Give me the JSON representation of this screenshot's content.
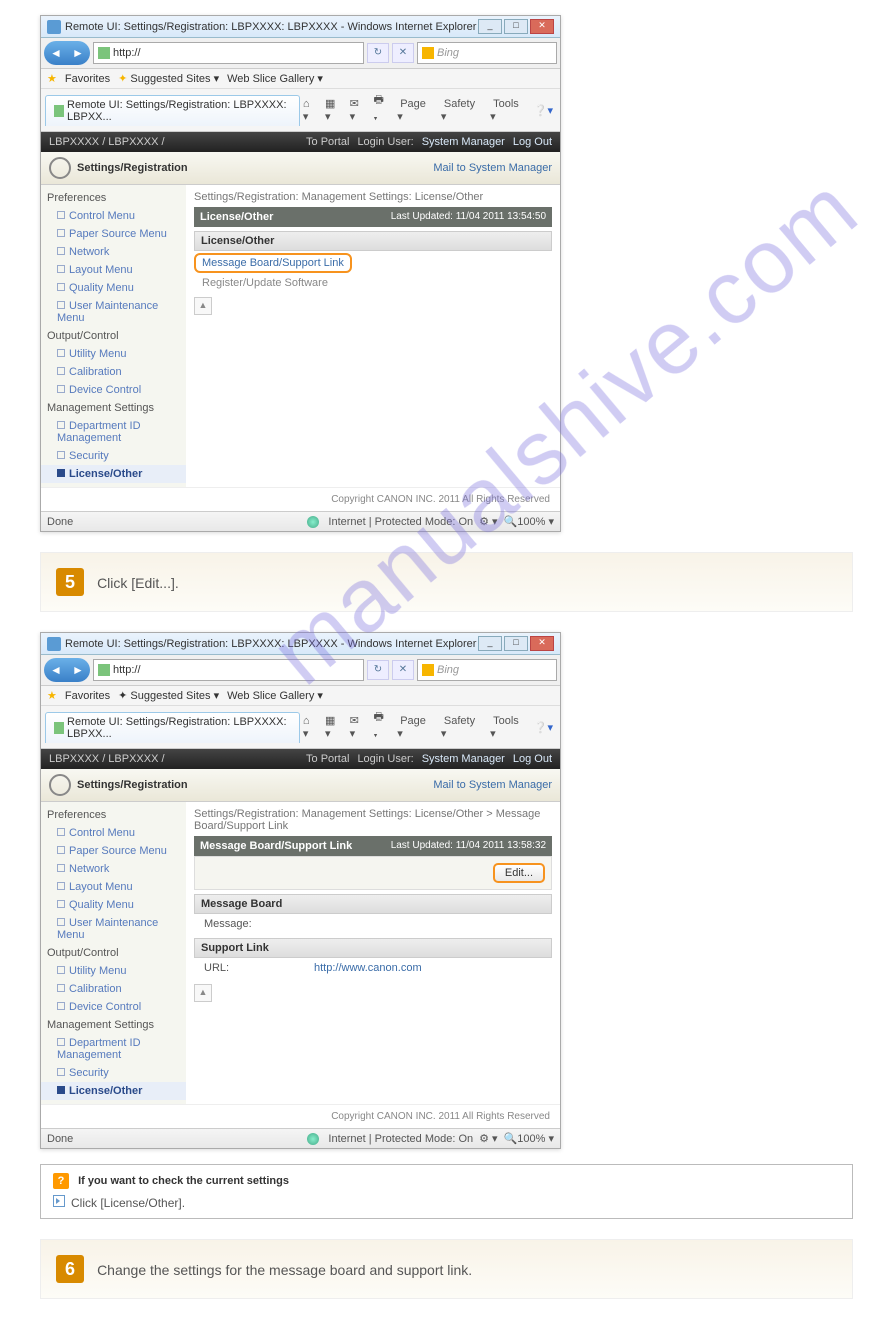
{
  "watermark": "manualshive.com",
  "browser_title": "Remote UI: Settings/Registration: LBPXXXX: LBPXXXX - Windows Internet Explorer",
  "url_scheme": "http://",
  "search_engine": "Bing",
  "favorites": "Favorites",
  "suggested": "Suggested Sites",
  "webslice": "Web Slice Gallery",
  "tab_title": "Remote UI: Settings/Registration: LBPXXXX: LBPXX...",
  "cmdbar": {
    "page": "Page",
    "safety": "Safety",
    "tools": "Tools"
  },
  "device_path": "LBPXXXX / LBPXXXX /",
  "header_links": {
    "portal": "To Portal",
    "login": "Login User:",
    "user": "System Manager",
    "logout": "Log Out",
    "mail": "Mail to System Manager"
  },
  "settings_reg": "Settings/Registration",
  "sidebar": {
    "prefs": "Preferences",
    "items1": [
      "Control Menu",
      "Paper Source Menu",
      "Network",
      "Layout Menu",
      "Quality Menu",
      "User Maintenance Menu"
    ],
    "output": "Output/Control",
    "items2": [
      "Utility Menu",
      "Calibration",
      "Device Control"
    ],
    "mgmt": "Management Settings",
    "items3": [
      "Department ID Management",
      "Security",
      "License/Other"
    ]
  },
  "screen1": {
    "breadcrumb": "Settings/Registration: Management Settings: License/Other",
    "band_title": "License/Other",
    "updated": "Last Updated: 11/04 2011 13:54:50",
    "section": "License/Other",
    "link1": "Message Board/Support Link",
    "link2": "Register/Update Software"
  },
  "screen2": {
    "breadcrumb": "Settings/Registration: Management Settings: License/Other > Message Board/Support Link",
    "band_title": "Message Board/Support Link",
    "updated": "Last Updated: 11/04 2011 13:58:32",
    "edit": "Edit...",
    "msgboard": "Message Board",
    "msg_lbl": "Message:",
    "support": "Support Link",
    "url_lbl": "URL:",
    "url_val": "http://www.canon.com"
  },
  "copyright": "Copyright CANON INC. 2011 All Rights Reserved",
  "status_done": "Done",
  "status_zone": "Internet | Protected Mode: On",
  "status_zoom": "100%",
  "step5": {
    "num": "5",
    "text": "Click [Edit...]."
  },
  "step6": {
    "num": "6",
    "text": "Change the settings for the message board and support link."
  },
  "note": {
    "title": "If you want to check the current settings",
    "text": "Click [License/Other]."
  }
}
